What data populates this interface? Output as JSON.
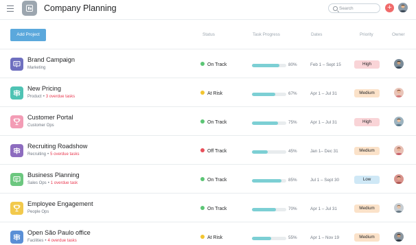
{
  "app": {
    "title": "Company Planning",
    "icon": "board-icon",
    "menu_icon": "hamburger-icon"
  },
  "search": {
    "placeholder": "Search",
    "value": ""
  },
  "toolbar": {
    "add_project_label": "Add Project",
    "add_icon": "plus-icon"
  },
  "columns": {
    "status": "Status",
    "task_progress": "Task Progress",
    "dates": "Dates",
    "priority": "Priority",
    "owner": "Owner"
  },
  "colors": {
    "on_track": "#5cc575",
    "at_risk": "#f2c530",
    "off_track": "#e8505b",
    "progress": "#7ccfd4",
    "priority_high": "#f9d4d7",
    "priority_medium": "#fbe2c9",
    "priority_low": "#cfe8f6",
    "accent": "#5ba8dc"
  },
  "projects": [
    {
      "name": "Brand Campaign",
      "team": "Marketing",
      "overdue": "",
      "icon_color": "#6e6fbf",
      "icon": "presentation-icon",
      "status": "On Track",
      "status_key": "on_track",
      "progress": 80,
      "progress_label": "80%",
      "dates": "Feb 1 – Sept 15",
      "priority": "High",
      "priority_key": "high"
    },
    {
      "name": "New Pricing",
      "team": "Product",
      "overdue": "3 overdue tasks",
      "icon_color": "#4fc3b4",
      "icon": "signpost-icon",
      "status": "At Risk",
      "status_key": "at_risk",
      "progress": 67,
      "progress_label": "67%",
      "dates": "Apr 1 – Jul 31",
      "priority": "Medium",
      "priority_key": "medium"
    },
    {
      "name": "Customer Portal",
      "team": "Customer Ops",
      "overdue": "",
      "icon_color": "#f39cb5",
      "icon": "trophy-icon",
      "status": "On Track",
      "status_key": "on_track",
      "progress": 75,
      "progress_label": "75%",
      "dates": "Apr 1 – Jul 31",
      "priority": "High",
      "priority_key": "high"
    },
    {
      "name": "Recruiting Roadshow",
      "team": "Recruiting",
      "overdue": "5 overdue tasks",
      "icon_color": "#8d6cbf",
      "icon": "signpost-icon",
      "status": "Off Track",
      "status_key": "off_track",
      "progress": 45,
      "progress_label": "45%",
      "dates": "Jan 1– Dec 31",
      "priority": "Medium",
      "priority_key": "medium"
    },
    {
      "name": "Business Planning",
      "team": "Sales Ops",
      "overdue": "1 overdue task",
      "icon_color": "#6cc77f",
      "icon": "presentation-icon",
      "status": "On Track",
      "status_key": "on_track",
      "progress": 85,
      "progress_label": "85%",
      "dates": "Jul 1 – Sept 30",
      "priority": "Low",
      "priority_key": "low"
    },
    {
      "name": "Employee Engagement",
      "team": "People Ops",
      "overdue": "",
      "icon_color": "#f2c94c",
      "icon": "trophy-icon",
      "status": "On Track",
      "status_key": "on_track",
      "progress": 70,
      "progress_label": "70%",
      "dates": "Apr 1 – Jul 31",
      "priority": "Medium",
      "priority_key": "medium"
    },
    {
      "name": "Open São Paulo office",
      "team": "Facilities",
      "overdue": "4 overdue tasks",
      "icon_color": "#5a8fd6",
      "icon": "signpost-icon",
      "status": "At Risk",
      "status_key": "at_risk",
      "progress": 55,
      "progress_label": "55%",
      "dates": "Apr 1 – Nov 19",
      "priority": "Medium",
      "priority_key": "medium"
    }
  ]
}
